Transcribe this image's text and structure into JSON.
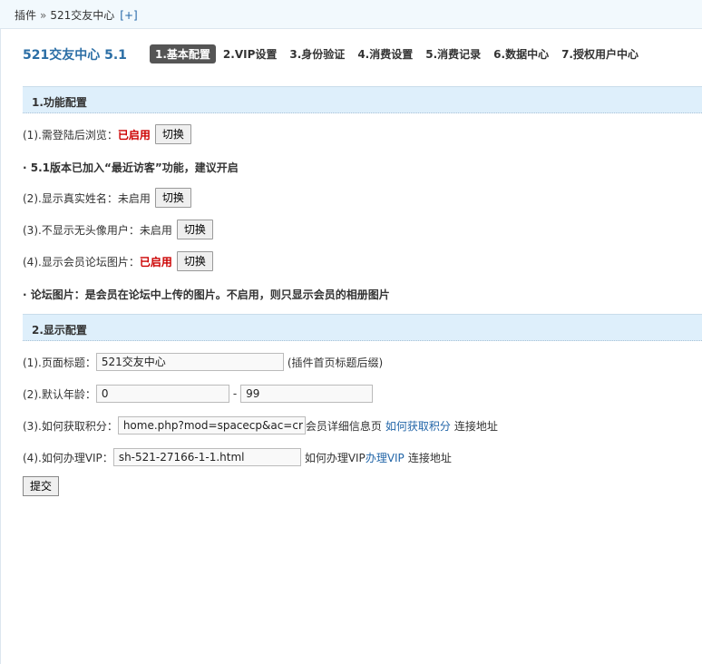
{
  "breadcrumb": {
    "root": "插件",
    "sep": "»",
    "current": "521交友中心",
    "plus": "[+]"
  },
  "app_title": "521交友中心 5.1",
  "tabs": [
    "1.基本配置",
    "2.VIP设置",
    "3.身份验证",
    "4.消费设置",
    "5.消费记录",
    "6.数据中心",
    "7.授权用户中心"
  ],
  "section1": {
    "title": "1.功能配置",
    "toggle_label": "切换",
    "items": [
      {
        "label": "(1).需登陆后浏览：",
        "status": "已启用"
      },
      {
        "label": "(2).显示真实姓名：",
        "status": "未启用"
      },
      {
        "label": "(3).不显示无头像用户：",
        "status": "未启用"
      },
      {
        "label": "(4).显示会员论坛图片：",
        "status": "已启用"
      }
    ],
    "note1": "· 5.1版本已加入“最近访客”功能，建议开启",
    "note2": "· 论坛图片：是会员在论坛中上传的图片。不启用，则只显示会员的相册图片"
  },
  "section2": {
    "title": "2.显示配置",
    "page_title": {
      "label": "(1).页面标题：",
      "value": "521交友中心",
      "hint": "(插件首页标题后缀)"
    },
    "age": {
      "label": "(2).默认年龄：",
      "min": "0",
      "dash": "-",
      "max": "99"
    },
    "points": {
      "label": "(3).如何获取积分：",
      "value": "home.php?mod=spacecp&ac=cr",
      "hint1": "会员详细信息页",
      "link": "如何获取积分",
      "hint2": "连接地址"
    },
    "vip": {
      "label": "(4).如何办理VIP：",
      "value": "sh-521-27166-1-1.html",
      "hint1": "如何办理VIP",
      "link": "办理VIP",
      "hint2": "连接地址"
    }
  },
  "submit_label": "提交"
}
